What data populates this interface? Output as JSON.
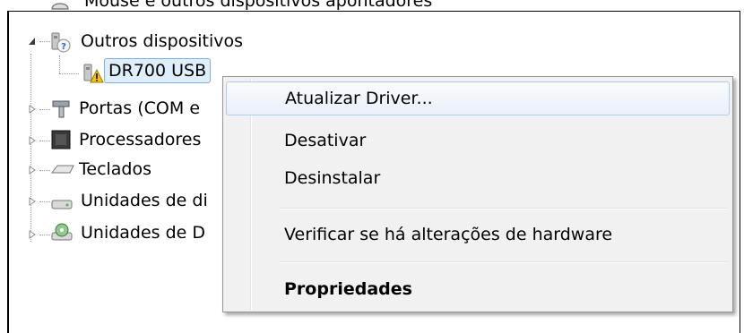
{
  "tree": {
    "top_partial_label": "Mouse e outros dispositivos apontadores",
    "other_devices": "Outros dispositivos",
    "dr700": "DR700 USB",
    "ports": "Portas (COM e",
    "processors": "Processadores",
    "keyboards": "Teclados",
    "disk_units": "Unidades de di",
    "dvd_units": "Unidades de D"
  },
  "context_menu": {
    "update_driver": "Atualizar Driver...",
    "disable": "Desativar",
    "uninstall": "Desinstalar",
    "scan_hardware": "Verificar se há alterações de hardware",
    "properties": "Propriedades"
  },
  "icons": {
    "mouse": "mouse-icon",
    "unknown_device": "unknown-device-icon",
    "warning_device": "warning-device-icon",
    "port": "port-icon",
    "processor": "processor-icon",
    "keyboard": "keyboard-icon",
    "disk": "disk-drive-icon",
    "dvd": "dvd-drive-icon"
  }
}
